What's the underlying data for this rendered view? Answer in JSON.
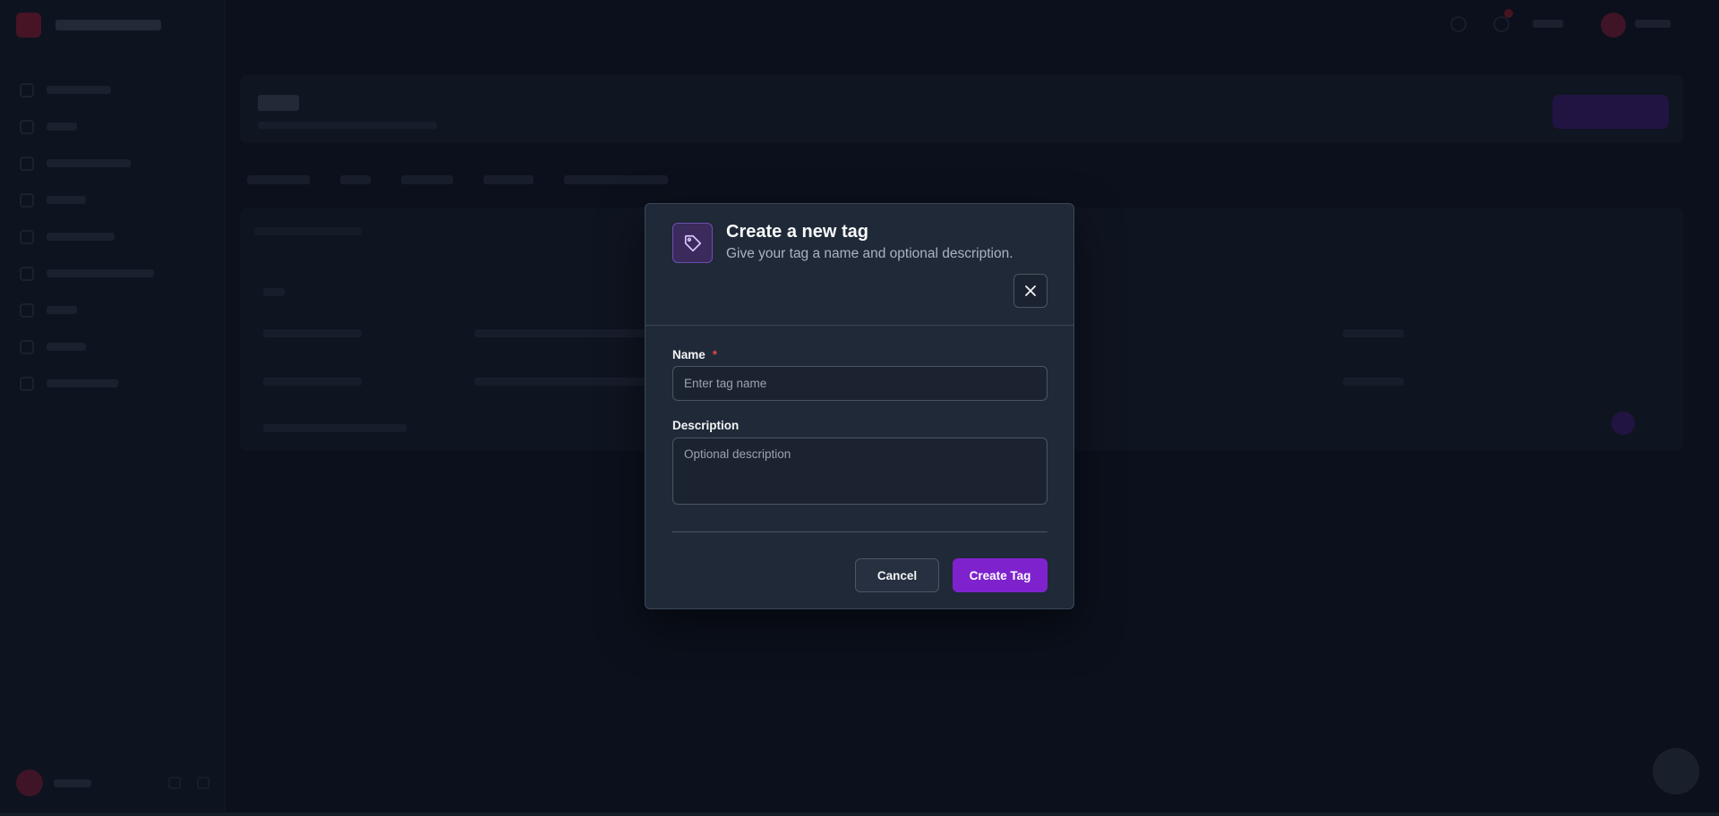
{
  "modal": {
    "title": "Create a new tag",
    "subtitle": "Give your tag a name and optional description.",
    "icon": "tag-icon",
    "close_icon": "close-icon",
    "name_field": {
      "label": "Name",
      "required_mark": "*",
      "placeholder": "Enter tag name",
      "value": ""
    },
    "description_field": {
      "label": "Description",
      "placeholder": "Optional description",
      "value": ""
    },
    "cancel_label": "Cancel",
    "submit_label": "Create Tag"
  },
  "colors": {
    "accent": "#7e22ce",
    "modal_bg": "#1f2937",
    "page_bg": "#0f1523",
    "required": "#e04552"
  }
}
